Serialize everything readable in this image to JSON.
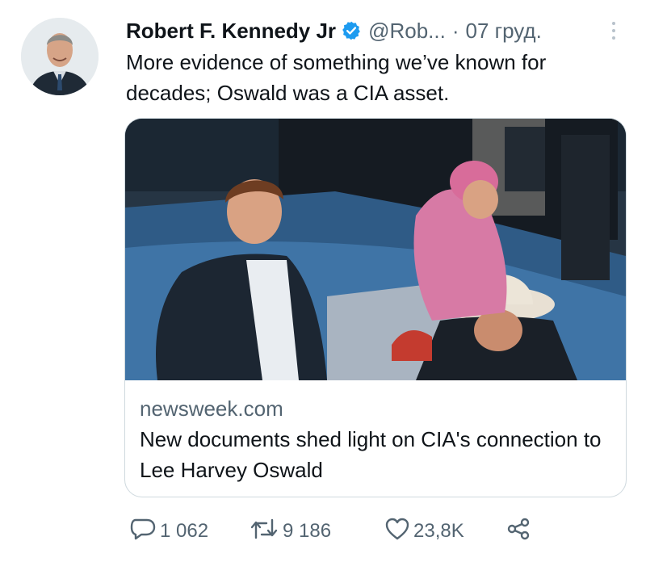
{
  "tweet": {
    "author_name": "Robert F. Kennedy Jr",
    "handle": "@Rob...",
    "separator": "·",
    "timestamp": "07 груд.",
    "text": "More evidence of something we’ve known for decades; Oswald was a CIA asset."
  },
  "card": {
    "domain": "newsweek.com",
    "title": "New documents shed light on CIA's connection to Lee Harvey Oswald"
  },
  "actions": {
    "replies": "1 062",
    "retweets": "9 186",
    "likes": "23,8K"
  },
  "icons": {
    "verified": "verified-badge-icon",
    "more": "more-options-icon",
    "reply": "reply-icon",
    "retweet": "retweet-icon",
    "like": "heart-icon",
    "share": "share-icon"
  },
  "colors": {
    "accent": "#1d9bf0",
    "secondary_text": "#536471",
    "border": "#cfd9de"
  }
}
